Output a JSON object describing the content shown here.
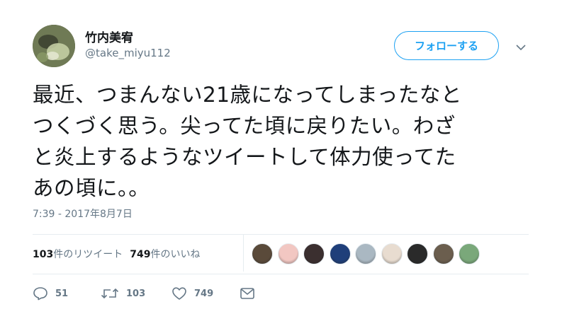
{
  "user": {
    "display_name": "竹内美宥",
    "handle": "@take_miyu112"
  },
  "follow_button_label": "フォローする",
  "tweet": {
    "text_lines": [
      "最近、つまんない21歳になってしまったなと",
      "つくづく思う。尖ってた頃に戻りたい。わざ",
      "と炎上するようなツイートして体力使ってた",
      "あの頃に。。"
    ],
    "timestamp": "7:39 - 2017年8月7日"
  },
  "stats": {
    "retweets_count": "103",
    "retweets_label": "件のリツイート",
    "likes_count": "749",
    "likes_label": "件のいいね"
  },
  "liker_avatars": [
    {
      "color": "#5a4a3a"
    },
    {
      "color": "#f2c7c2"
    },
    {
      "color": "#3b2f2f"
    },
    {
      "color": "#1f3f7a"
    },
    {
      "color": "#aab8c2"
    },
    {
      "color": "#e8dcd0"
    },
    {
      "color": "#2a2a2a"
    },
    {
      "color": "#6b5e4e"
    },
    {
      "color": "#7aa87a"
    }
  ],
  "actions": {
    "reply_count": "51",
    "retweet_count": "103",
    "like_count": "749"
  },
  "colors": {
    "accent": "#1da1f2",
    "muted": "#657786",
    "text": "#14171a",
    "divider": "#e6ecf0"
  }
}
